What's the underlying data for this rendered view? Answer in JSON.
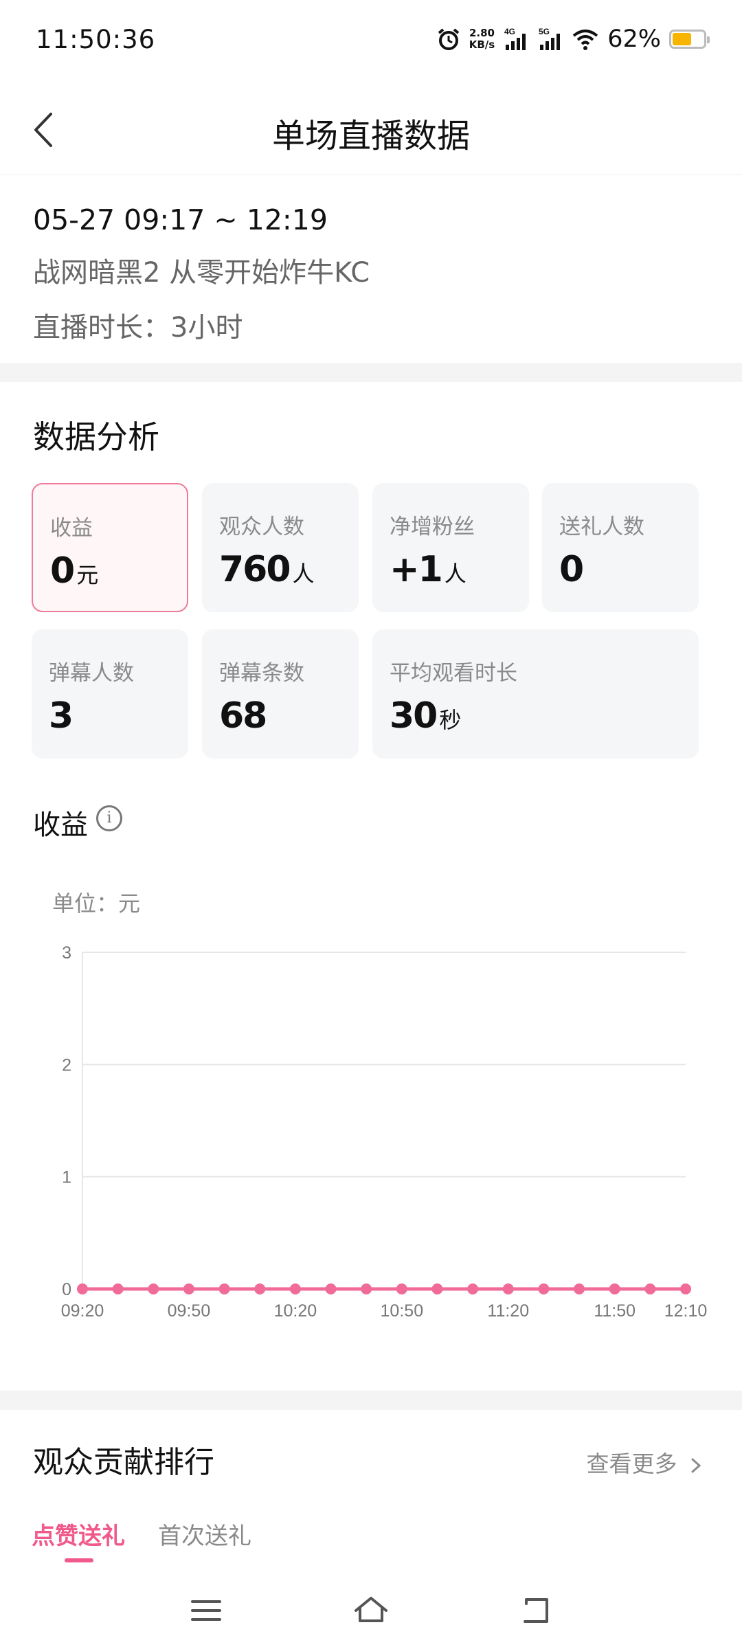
{
  "status_bar": {
    "time": "11:50:36",
    "speed_value": "2.80",
    "speed_unit": "KB/s",
    "net_4g": "4G",
    "net_5g": "5G",
    "battery_pct": "62%",
    "battery_level": 0.62,
    "battery_color": "#f7b500",
    "icons": [
      "alarm-icon",
      "signal-4g-icon",
      "signal-5g-icon",
      "wifi-icon",
      "battery-icon"
    ]
  },
  "header": {
    "title": "单场直播数据",
    "back_icon": "chevron-left-icon"
  },
  "session": {
    "time_range": "05-27 09:17 ~ 12:19",
    "name": "战网暗黑2 从零开始炸牛KC",
    "duration": "直播时长：3小时"
  },
  "analysis": {
    "title": "数据分析",
    "cards": [
      {
        "label": "收益",
        "value": "0",
        "unit": "元"
      },
      {
        "label": "观众人数",
        "value": "760",
        "unit": "人"
      },
      {
        "label": "净增粉丝",
        "value": "+1",
        "unit": "人"
      },
      {
        "label": "送礼人数",
        "value": "0",
        "unit": ""
      },
      {
        "label": "弹幕人数",
        "value": "3",
        "unit": ""
      },
      {
        "label": "弹幕条数",
        "value": "68",
        "unit": ""
      },
      {
        "label": "平均观看时长",
        "value": "30",
        "unit": "秒"
      }
    ]
  },
  "revenue": {
    "title": "收益",
    "unit_label": "单位：元",
    "info_icon": "info-icon"
  },
  "chart_data": {
    "type": "line",
    "ylim": [
      0,
      3
    ],
    "yticks": [
      "0",
      "1",
      "2",
      "3"
    ],
    "xtick_labels": [
      "09:20",
      "09:50",
      "10:20",
      "10:50",
      "11:20",
      "11:50",
      "12:10"
    ],
    "x": [
      "09:20",
      "09:30",
      "09:40",
      "09:50",
      "10:00",
      "10:10",
      "10:20",
      "10:30",
      "10:40",
      "10:50",
      "11:00",
      "11:10",
      "11:20",
      "11:30",
      "11:40",
      "11:50",
      "12:00",
      "12:10"
    ],
    "values": [
      0,
      0,
      0,
      0,
      0,
      0,
      0,
      0,
      0,
      0,
      0,
      0,
      0,
      0,
      0,
      0,
      0,
      0
    ],
    "line_color": "#f06b97",
    "grid": true
  },
  "ranking": {
    "title": "观众贡献排行",
    "more": "查看更多",
    "more_icon": "chevron-right-icon",
    "tabs": [
      "点赞送礼",
      "首次送礼"
    ]
  },
  "nav": {
    "icons": [
      "menu-icon",
      "home-icon",
      "back-icon"
    ]
  },
  "colors": {
    "accent": "#f0598a",
    "card_bg": "#f5f6f8",
    "divider": "#f4f4f5"
  }
}
